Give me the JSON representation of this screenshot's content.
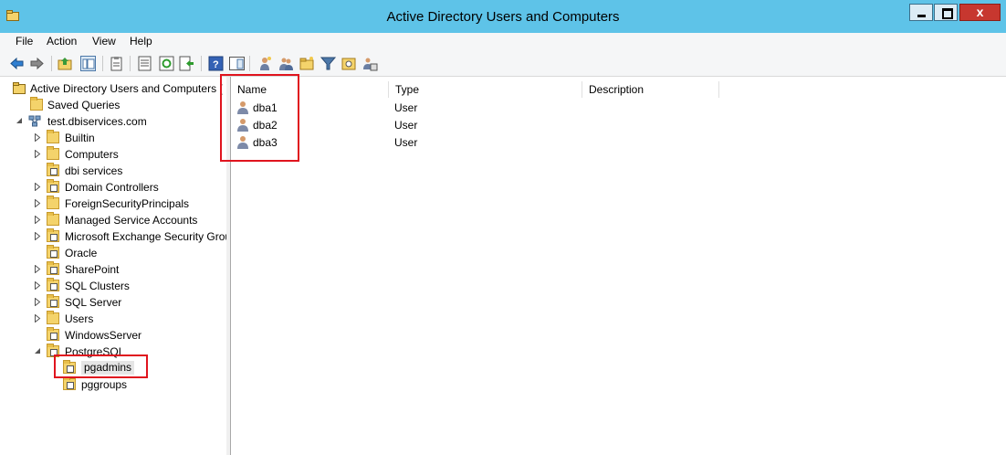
{
  "window": {
    "title": "Active Directory Users and Computers",
    "close_glyph": "x"
  },
  "menu": [
    "File",
    "Action",
    "View",
    "Help"
  ],
  "toolbar": {
    "icons": [
      "back-icon",
      "forward-icon",
      "up-folder-icon",
      "show-tree-icon",
      "clipboard-icon",
      "properties-icon",
      "refresh-icon",
      "export-list-icon",
      "help-icon",
      "action-pane-icon",
      "new-user-icon",
      "new-group-icon",
      "new-ou-icon",
      "filter-icon",
      "find-icon",
      "move-icon"
    ]
  },
  "tree": {
    "root": "Active Directory Users and Computers [",
    "saved_queries": "Saved Queries",
    "domain": "test.dbiservices.com",
    "items": [
      {
        "label": "Builtin",
        "expandable": true
      },
      {
        "label": "Computers",
        "expandable": true
      },
      {
        "label": "dbi services",
        "expandable": false
      },
      {
        "label": "Domain Controllers",
        "expandable": true
      },
      {
        "label": "ForeignSecurityPrincipals",
        "expandable": true
      },
      {
        "label": "Managed Service Accounts",
        "expandable": true
      },
      {
        "label": "Microsoft Exchange Security Grou",
        "expandable": true
      },
      {
        "label": "Oracle",
        "expandable": false
      },
      {
        "label": "SharePoint",
        "expandable": true
      },
      {
        "label": "SQL Clusters",
        "expandable": true
      },
      {
        "label": "SQL Server",
        "expandable": true
      },
      {
        "label": "Users",
        "expandable": true
      },
      {
        "label": "WindowsServer",
        "expandable": false
      },
      {
        "label": "PostgreSQL",
        "expandable": true
      }
    ],
    "children": [
      "pgadmins",
      "pggroups"
    ]
  },
  "list": {
    "columns": [
      "Name",
      "Type",
      "Description"
    ],
    "rows": [
      {
        "name": "dba1",
        "type": "User",
        "description": ""
      },
      {
        "name": "dba2",
        "type": "User",
        "description": ""
      },
      {
        "name": "dba3",
        "type": "User",
        "description": ""
      }
    ]
  },
  "colors": {
    "titlebar": "#5ec3e8",
    "highlight_box": "#e0141e",
    "close_button": "#c7372f"
  }
}
